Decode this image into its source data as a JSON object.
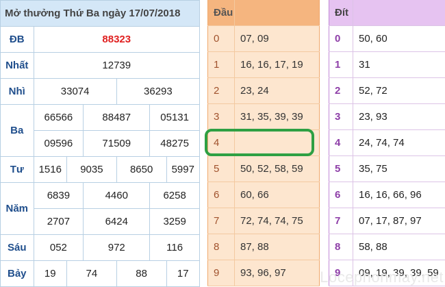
{
  "results": {
    "title": "Mở thưởng Thứ Ba ngày 17/07/2018",
    "rows": [
      {
        "label": "ĐB",
        "values": [
          "88323"
        ]
      },
      {
        "label": "Nhất",
        "values": [
          "12739"
        ]
      },
      {
        "label": "Nhì",
        "values": [
          "33074",
          "36293"
        ]
      },
      {
        "label": "Ba",
        "values": [
          "66566",
          "88487",
          "05131",
          "09596",
          "71509",
          "48275"
        ]
      },
      {
        "label": "Tư",
        "values": [
          "1516",
          "9035",
          "8650",
          "5997"
        ]
      },
      {
        "label": "Năm",
        "values": [
          "6839",
          "4460",
          "6258",
          "2707",
          "6424",
          "3259"
        ]
      },
      {
        "label": "Sáu",
        "values": [
          "052",
          "972",
          "116"
        ]
      },
      {
        "label": "Bảy",
        "values": [
          "19",
          "74",
          "88",
          "17"
        ]
      }
    ]
  },
  "dau": {
    "header": "Đầu",
    "rows": [
      {
        "key": "0",
        "value": "07, 09"
      },
      {
        "key": "1",
        "value": "16, 16, 17, 19"
      },
      {
        "key": "2",
        "value": "23, 24"
      },
      {
        "key": "3",
        "value": "31, 35, 39, 39"
      },
      {
        "key": "4",
        "value": ""
      },
      {
        "key": "5",
        "value": "50, 52, 58, 59"
      },
      {
        "key": "6",
        "value": "60, 66"
      },
      {
        "key": "7",
        "value": "72, 74, 74, 75"
      },
      {
        "key": "8",
        "value": "87, 88"
      },
      {
        "key": "9",
        "value": "93, 96, 97"
      }
    ]
  },
  "dit": {
    "header": "Đít",
    "rows": [
      {
        "key": "0",
        "value": "50, 60"
      },
      {
        "key": "1",
        "value": "31"
      },
      {
        "key": "2",
        "value": "52, 72"
      },
      {
        "key": "3",
        "value": "23, 93"
      },
      {
        "key": "4",
        "value": "24, 74, 74"
      },
      {
        "key": "5",
        "value": "35, 75"
      },
      {
        "key": "6",
        "value": "16, 16, 66, 96"
      },
      {
        "key": "7",
        "value": "07, 17, 87, 97"
      },
      {
        "key": "8",
        "value": "58, 88"
      },
      {
        "key": "9",
        "value": "09, 19, 39, 39, 59"
      }
    ]
  },
  "watermark": "Locephonmay.net",
  "colors": {
    "special": "#e02020",
    "highlight": "#2ea043",
    "dau_bg": "#fde6cf",
    "dit_header": "#e6c3f1"
  }
}
